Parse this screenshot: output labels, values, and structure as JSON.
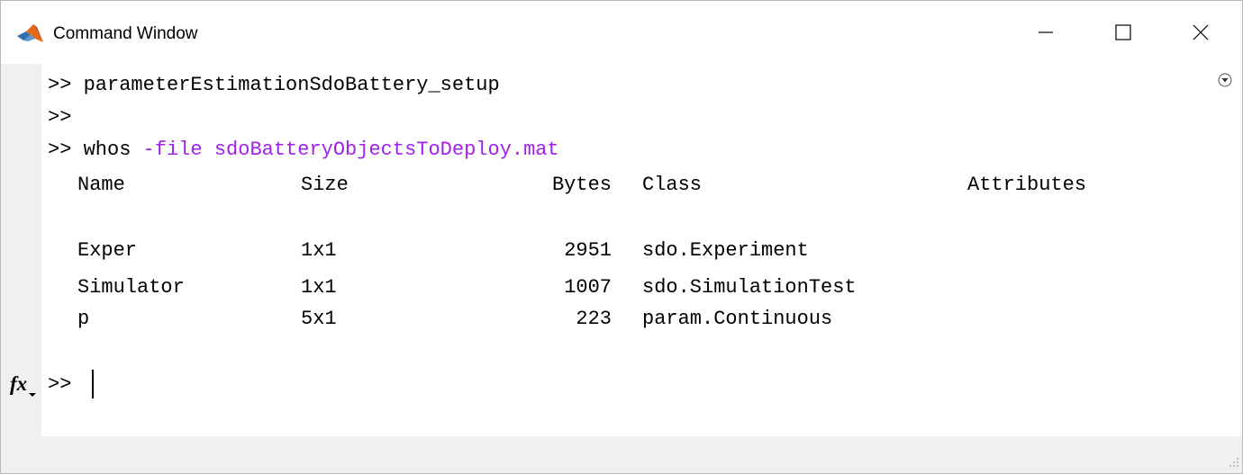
{
  "window": {
    "title": "Command Window",
    "app_icon": "matlab-logo-icon",
    "controls": {
      "minimize_icon": "minimize-icon",
      "maximize_icon": "maximize-icon",
      "close_icon": "close-icon"
    }
  },
  "console": {
    "options_icon": "chevron-down-circle-icon",
    "fx_icon": "function-browser-icon",
    "fx_label": "fx",
    "lines": [
      {
        "prompt": ">>",
        "command": "parameterEstimationSdoBattery_setup",
        "arg": ""
      },
      {
        "prompt": ">>",
        "command": "",
        "arg": ""
      },
      {
        "prompt": ">>",
        "command": "whos",
        "arg": "-file sdoBatteryObjectsToDeploy.mat"
      }
    ],
    "whos_table": {
      "headers": [
        "Name",
        "Size",
        "Bytes",
        "Class",
        "Attributes"
      ],
      "rows": [
        {
          "name": "Exper",
          "size": "1x1",
          "bytes": "2951",
          "class": "sdo.Experiment",
          "attributes": ""
        },
        {
          "name": "Simulator",
          "size": "1x1",
          "bytes": "1007",
          "class": "sdo.SimulationTest",
          "attributes": ""
        },
        {
          "name": "p",
          "size": "5x1",
          "bytes": "223",
          "class": "param.Continuous",
          "attributes": ""
        }
      ]
    },
    "active_prompt": ">>",
    "input_value": ""
  },
  "colors": {
    "keyword_purple": "#a020f0",
    "text": "#000000",
    "background": "#ffffff",
    "frame": "#f0f0f0"
  }
}
